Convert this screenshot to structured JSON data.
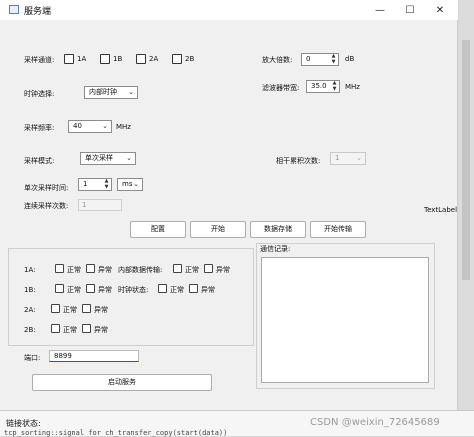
{
  "window": {
    "title": "服务端"
  },
  "titlebar_buttons": {
    "minimize": "—",
    "maximize": "☐",
    "close": "✕"
  },
  "channel": {
    "label": "采样通道:",
    "options": [
      {
        "label": "1A",
        "checked": false
      },
      {
        "label": "1B",
        "checked": false
      },
      {
        "label": "2A",
        "checked": false
      },
      {
        "label": "2B",
        "checked": false
      }
    ]
  },
  "gain": {
    "label": "放大倍数:",
    "value": "0",
    "unit": "dB"
  },
  "clock": {
    "label": "时钟选择:",
    "value": "内部时钟"
  },
  "filter": {
    "label": "滤波器带宽:",
    "value": "35.0",
    "unit": "MHz"
  },
  "sample_rate": {
    "label": "采样频率:",
    "value": "40",
    "unit": "MHz"
  },
  "sample_mode": {
    "label": "采样模式:",
    "value": "单次采样"
  },
  "coherent": {
    "label": "相干累积次数:",
    "value": "1"
  },
  "single_time": {
    "label": "单次采样时间:",
    "value": "1",
    "unit": "ms"
  },
  "continuous": {
    "label": "连续采样次数:",
    "value": "1"
  },
  "text_label": "TextLabel",
  "buttons": {
    "config": "配置",
    "start": "开始",
    "save": "数据存储",
    "transfer": "开始传输",
    "start_service": "启动服务"
  },
  "status": {
    "rows": [
      {
        "label": "1A:",
        "normal": "正常",
        "abnormal": "异常",
        "extra_label": "内部数据传输:",
        "extra_normal": "正常",
        "extra_abnormal": "异常"
      },
      {
        "label": "1B:",
        "normal": "正常",
        "abnormal": "异常",
        "extra_label": "时钟状态:",
        "extra_normal": "正常",
        "extra_abnormal": "异常"
      },
      {
        "label": "2A:",
        "normal": "正常",
        "abnormal": "异常"
      },
      {
        "label": "2B:",
        "normal": "正常",
        "abnormal": "异常"
      }
    ]
  },
  "port": {
    "label": "端口:",
    "value": "8899"
  },
  "comm_log": {
    "label": "通信记录:",
    "content": ""
  },
  "background": {
    "status_label": "链接状态:",
    "code_line": "tcp_sorting::signal for ch_transfer_copy(start(data))",
    "watermark": "CSDN @weixin_72645689"
  }
}
